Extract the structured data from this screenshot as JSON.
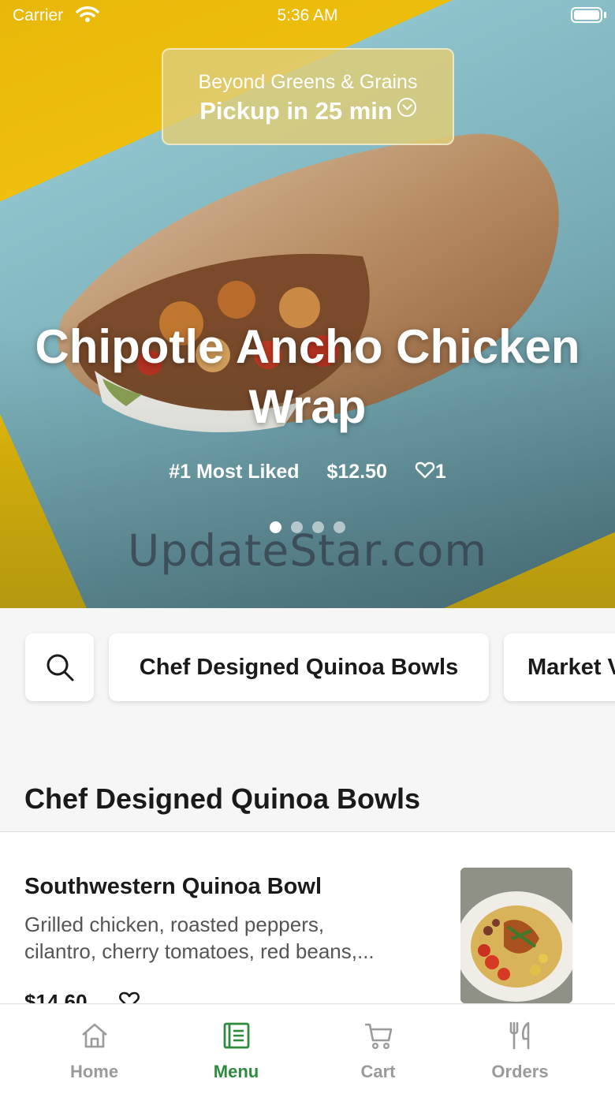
{
  "status_bar": {
    "carrier": "Carrier",
    "time": "5:36 AM"
  },
  "hero": {
    "store_name": "Beyond Greens & Grains",
    "pickup": "Pickup in 25 min",
    "title": "Chipotle Ancho Chicken Wrap",
    "badge": "#1 Most Liked",
    "price": "$12.50",
    "likes": "1",
    "carousel_dots": 4,
    "carousel_active": 0,
    "watermark": "UpdateStar.com"
  },
  "categories": {
    "items": [
      "Chef Designed Quinoa Bowls",
      "Market V"
    ]
  },
  "section": {
    "title": "Chef Designed Quinoa Bowls"
  },
  "menu_item": {
    "name": "Southwestern Quinoa Bowl",
    "description_line1": "Grilled chicken, roasted peppers,",
    "description_line2": "cilantro, cherry tomatoes, red beans,...",
    "price": "$14.60"
  },
  "tab_bar": {
    "tabs": [
      {
        "label": "Home",
        "icon": "home-icon"
      },
      {
        "label": "Menu",
        "icon": "menu-icon"
      },
      {
        "label": "Cart",
        "icon": "cart-icon"
      },
      {
        "label": "Orders",
        "icon": "utensils-icon"
      }
    ],
    "active_index": 1
  },
  "colors": {
    "accent": "#2e8b3e",
    "hero_yellow": "#f2c40d",
    "hero_blue": "#8fc3cc"
  }
}
